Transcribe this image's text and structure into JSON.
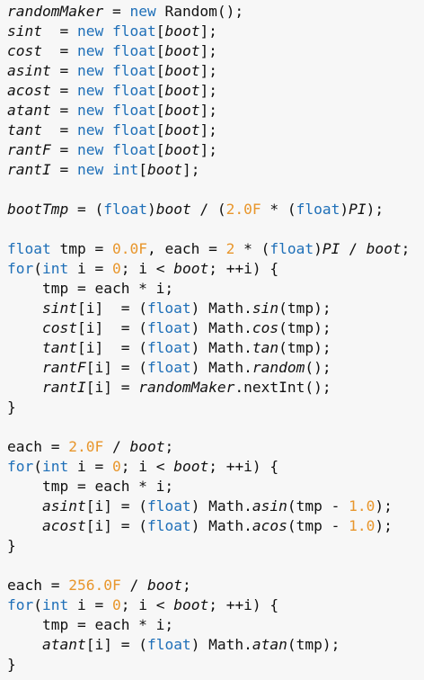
{
  "editor": {
    "language": "java",
    "colors": {
      "background": "#f7f7f7",
      "text": "#111111",
      "keyword": "#1e6fb8",
      "number": "#e8962c"
    },
    "lines": [
      [
        {
          "t": "randomMaker",
          "k": "var"
        },
        {
          "t": " = ",
          "k": "p"
        },
        {
          "t": "new",
          "k": "kw"
        },
        {
          "t": " Random();",
          "k": "p"
        }
      ],
      [
        {
          "t": "sint",
          "k": "var"
        },
        {
          "t": "  = ",
          "k": "p"
        },
        {
          "t": "new",
          "k": "kw"
        },
        {
          "t": " ",
          "k": "p"
        },
        {
          "t": "float",
          "k": "kw"
        },
        {
          "t": "[",
          "k": "p"
        },
        {
          "t": "boot",
          "k": "var"
        },
        {
          "t": "];",
          "k": "p"
        }
      ],
      [
        {
          "t": "cost",
          "k": "var"
        },
        {
          "t": "  = ",
          "k": "p"
        },
        {
          "t": "new",
          "k": "kw"
        },
        {
          "t": " ",
          "k": "p"
        },
        {
          "t": "float",
          "k": "kw"
        },
        {
          "t": "[",
          "k": "p"
        },
        {
          "t": "boot",
          "k": "var"
        },
        {
          "t": "];",
          "k": "p"
        }
      ],
      [
        {
          "t": "asint",
          "k": "var"
        },
        {
          "t": " = ",
          "k": "p"
        },
        {
          "t": "new",
          "k": "kw"
        },
        {
          "t": " ",
          "k": "p"
        },
        {
          "t": "float",
          "k": "kw"
        },
        {
          "t": "[",
          "k": "p"
        },
        {
          "t": "boot",
          "k": "var"
        },
        {
          "t": "];",
          "k": "p"
        }
      ],
      [
        {
          "t": "acost",
          "k": "var"
        },
        {
          "t": " = ",
          "k": "p"
        },
        {
          "t": "new",
          "k": "kw"
        },
        {
          "t": " ",
          "k": "p"
        },
        {
          "t": "float",
          "k": "kw"
        },
        {
          "t": "[",
          "k": "p"
        },
        {
          "t": "boot",
          "k": "var"
        },
        {
          "t": "];",
          "k": "p"
        }
      ],
      [
        {
          "t": "atant",
          "k": "var"
        },
        {
          "t": " = ",
          "k": "p"
        },
        {
          "t": "new",
          "k": "kw"
        },
        {
          "t": " ",
          "k": "p"
        },
        {
          "t": "float",
          "k": "kw"
        },
        {
          "t": "[",
          "k": "p"
        },
        {
          "t": "boot",
          "k": "var"
        },
        {
          "t": "];",
          "k": "p"
        }
      ],
      [
        {
          "t": "tant",
          "k": "var"
        },
        {
          "t": "  = ",
          "k": "p"
        },
        {
          "t": "new",
          "k": "kw"
        },
        {
          "t": " ",
          "k": "p"
        },
        {
          "t": "float",
          "k": "kw"
        },
        {
          "t": "[",
          "k": "p"
        },
        {
          "t": "boot",
          "k": "var"
        },
        {
          "t": "];",
          "k": "p"
        }
      ],
      [
        {
          "t": "rantF",
          "k": "var"
        },
        {
          "t": " = ",
          "k": "p"
        },
        {
          "t": "new",
          "k": "kw"
        },
        {
          "t": " ",
          "k": "p"
        },
        {
          "t": "float",
          "k": "kw"
        },
        {
          "t": "[",
          "k": "p"
        },
        {
          "t": "boot",
          "k": "var"
        },
        {
          "t": "];",
          "k": "p"
        }
      ],
      [
        {
          "t": "rantI",
          "k": "var"
        },
        {
          "t": " = ",
          "k": "p"
        },
        {
          "t": "new",
          "k": "kw"
        },
        {
          "t": " ",
          "k": "p"
        },
        {
          "t": "int",
          "k": "kw"
        },
        {
          "t": "[",
          "k": "p"
        },
        {
          "t": "boot",
          "k": "var"
        },
        {
          "t": "];",
          "k": "p"
        }
      ],
      [],
      [
        {
          "t": "bootTmp",
          "k": "var"
        },
        {
          "t": " = (",
          "k": "p"
        },
        {
          "t": "float",
          "k": "kw"
        },
        {
          "t": ")",
          "k": "p"
        },
        {
          "t": "boot",
          "k": "var"
        },
        {
          "t": " / (",
          "k": "p"
        },
        {
          "t": "2.0F",
          "k": "num"
        },
        {
          "t": " * (",
          "k": "p"
        },
        {
          "t": "float",
          "k": "kw"
        },
        {
          "t": ")",
          "k": "p"
        },
        {
          "t": "PI",
          "k": "var"
        },
        {
          "t": ");",
          "k": "p"
        }
      ],
      [],
      [
        {
          "t": "float",
          "k": "kw"
        },
        {
          "t": " tmp = ",
          "k": "p"
        },
        {
          "t": "0.0F",
          "k": "num"
        },
        {
          "t": ", each = ",
          "k": "p"
        },
        {
          "t": "2",
          "k": "num"
        },
        {
          "t": " * (",
          "k": "p"
        },
        {
          "t": "float",
          "k": "kw"
        },
        {
          "t": ")",
          "k": "p"
        },
        {
          "t": "PI",
          "k": "var"
        },
        {
          "t": " / ",
          "k": "p"
        },
        {
          "t": "boot",
          "k": "var"
        },
        {
          "t": ";",
          "k": "p"
        }
      ],
      [
        {
          "t": "for",
          "k": "kw"
        },
        {
          "t": "(",
          "k": "p"
        },
        {
          "t": "int",
          "k": "kw"
        },
        {
          "t": " i = ",
          "k": "p"
        },
        {
          "t": "0",
          "k": "num"
        },
        {
          "t": "; i < ",
          "k": "p"
        },
        {
          "t": "boot",
          "k": "var"
        },
        {
          "t": "; ++i) {",
          "k": "p"
        }
      ],
      [
        {
          "t": "    tmp = each * i;",
          "k": "p"
        }
      ],
      [
        {
          "t": "    ",
          "k": "p"
        },
        {
          "t": "sint",
          "k": "var"
        },
        {
          "t": "[i]  = (",
          "k": "p"
        },
        {
          "t": "float",
          "k": "kw"
        },
        {
          "t": ") Math.",
          "k": "p"
        },
        {
          "t": "sin",
          "k": "fn"
        },
        {
          "t": "(tmp);",
          "k": "p"
        }
      ],
      [
        {
          "t": "    ",
          "k": "p"
        },
        {
          "t": "cost",
          "k": "var"
        },
        {
          "t": "[i]  = (",
          "k": "p"
        },
        {
          "t": "float",
          "k": "kw"
        },
        {
          "t": ") Math.",
          "k": "p"
        },
        {
          "t": "cos",
          "k": "fn"
        },
        {
          "t": "(tmp);",
          "k": "p"
        }
      ],
      [
        {
          "t": "    ",
          "k": "p"
        },
        {
          "t": "tant",
          "k": "var"
        },
        {
          "t": "[i]  = (",
          "k": "p"
        },
        {
          "t": "float",
          "k": "kw"
        },
        {
          "t": ") Math.",
          "k": "p"
        },
        {
          "t": "tan",
          "k": "fn"
        },
        {
          "t": "(tmp);",
          "k": "p"
        }
      ],
      [
        {
          "t": "    ",
          "k": "p"
        },
        {
          "t": "rantF",
          "k": "var"
        },
        {
          "t": "[i] = (",
          "k": "p"
        },
        {
          "t": "float",
          "k": "kw"
        },
        {
          "t": ") Math.",
          "k": "p"
        },
        {
          "t": "random",
          "k": "fn"
        },
        {
          "t": "();",
          "k": "p"
        }
      ],
      [
        {
          "t": "    ",
          "k": "p"
        },
        {
          "t": "rantI",
          "k": "var"
        },
        {
          "t": "[i] = ",
          "k": "p"
        },
        {
          "t": "randomMaker",
          "k": "var"
        },
        {
          "t": ".nextInt();",
          "k": "p"
        }
      ],
      [
        {
          "t": "}",
          "k": "p"
        }
      ],
      [],
      [
        {
          "t": "each = ",
          "k": "p"
        },
        {
          "t": "2.0F",
          "k": "num"
        },
        {
          "t": " / ",
          "k": "p"
        },
        {
          "t": "boot",
          "k": "var"
        },
        {
          "t": ";",
          "k": "p"
        }
      ],
      [
        {
          "t": "for",
          "k": "kw"
        },
        {
          "t": "(",
          "k": "p"
        },
        {
          "t": "int",
          "k": "kw"
        },
        {
          "t": " i = ",
          "k": "p"
        },
        {
          "t": "0",
          "k": "num"
        },
        {
          "t": "; i < ",
          "k": "p"
        },
        {
          "t": "boot",
          "k": "var"
        },
        {
          "t": "; ++i) {",
          "k": "p"
        }
      ],
      [
        {
          "t": "    tmp = each * i;",
          "k": "p"
        }
      ],
      [
        {
          "t": "    ",
          "k": "p"
        },
        {
          "t": "asint",
          "k": "var"
        },
        {
          "t": "[i] = (",
          "k": "p"
        },
        {
          "t": "float",
          "k": "kw"
        },
        {
          "t": ") Math.",
          "k": "p"
        },
        {
          "t": "asin",
          "k": "fn"
        },
        {
          "t": "(tmp - ",
          "k": "p"
        },
        {
          "t": "1.0",
          "k": "num"
        },
        {
          "t": ");",
          "k": "p"
        }
      ],
      [
        {
          "t": "    ",
          "k": "p"
        },
        {
          "t": "acost",
          "k": "var"
        },
        {
          "t": "[i] = (",
          "k": "p"
        },
        {
          "t": "float",
          "k": "kw"
        },
        {
          "t": ") Math.",
          "k": "p"
        },
        {
          "t": "acos",
          "k": "fn"
        },
        {
          "t": "(tmp - ",
          "k": "p"
        },
        {
          "t": "1.0",
          "k": "num"
        },
        {
          "t": ");",
          "k": "p"
        }
      ],
      [
        {
          "t": "}",
          "k": "p"
        }
      ],
      [],
      [
        {
          "t": "each = ",
          "k": "p"
        },
        {
          "t": "256.0F",
          "k": "num"
        },
        {
          "t": " / ",
          "k": "p"
        },
        {
          "t": "boot",
          "k": "var"
        },
        {
          "t": ";",
          "k": "p"
        }
      ],
      [
        {
          "t": "for",
          "k": "kw"
        },
        {
          "t": "(",
          "k": "p"
        },
        {
          "t": "int",
          "k": "kw"
        },
        {
          "t": " i = ",
          "k": "p"
        },
        {
          "t": "0",
          "k": "num"
        },
        {
          "t": "; i < ",
          "k": "p"
        },
        {
          "t": "boot",
          "k": "var"
        },
        {
          "t": "; ++i) {",
          "k": "p"
        }
      ],
      [
        {
          "t": "    tmp = each * i;",
          "k": "p"
        }
      ],
      [
        {
          "t": "    ",
          "k": "p"
        },
        {
          "t": "atant",
          "k": "var"
        },
        {
          "t": "[i] = (",
          "k": "p"
        },
        {
          "t": "float",
          "k": "kw"
        },
        {
          "t": ") Math.",
          "k": "p"
        },
        {
          "t": "atan",
          "k": "fn"
        },
        {
          "t": "(tmp);",
          "k": "p"
        }
      ],
      [
        {
          "t": "}",
          "k": "p"
        }
      ]
    ]
  }
}
